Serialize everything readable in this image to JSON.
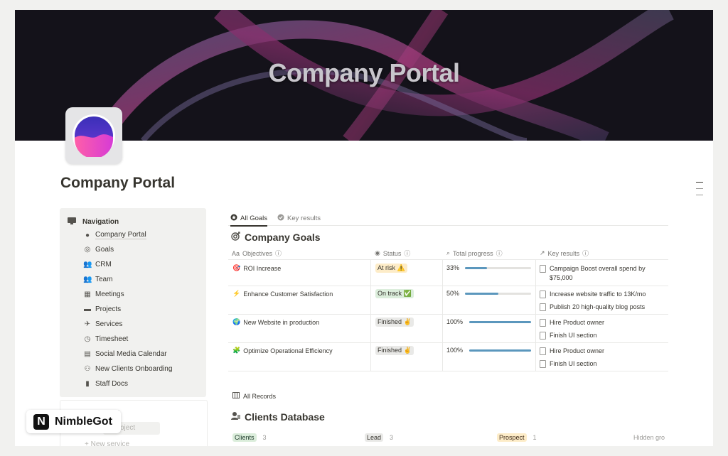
{
  "cover": {
    "title": "Company Portal"
  },
  "page": {
    "title": "Company Portal"
  },
  "navigation": {
    "heading": "Navigation",
    "items": [
      {
        "label": "Company Portal",
        "icon": "portal-icon"
      },
      {
        "label": "Goals",
        "icon": "target-icon"
      },
      {
        "label": "CRM",
        "icon": "people-icon"
      },
      {
        "label": "Team",
        "icon": "team-icon"
      },
      {
        "label": "Meetings",
        "icon": "calendar-icon"
      },
      {
        "label": "Projects",
        "icon": "folder-icon"
      },
      {
        "label": "Services",
        "icon": "airplane-icon"
      },
      {
        "label": "Timesheet",
        "icon": "clock-icon"
      },
      {
        "label": "Social Media Calendar",
        "icon": "calendar-grid-icon"
      },
      {
        "label": "New Clients Onboarding",
        "icon": "group-icon"
      },
      {
        "label": "Staff Docs",
        "icon": "book-icon"
      }
    ],
    "partial": {
      "heading_fragment": "s",
      "project_fragment": "oject",
      "service_fragment": "New service"
    }
  },
  "brand": {
    "logo_letter": "N",
    "name": "NimbleGot"
  },
  "tabs": [
    {
      "label": "All Goals",
      "active": true
    },
    {
      "label": "Key results",
      "active": false
    }
  ],
  "goals": {
    "title": "Company Goals",
    "headers": {
      "objectives": "Objectives",
      "status": "Status",
      "progress": "Total progress",
      "key_results": "Key results"
    },
    "rows": [
      {
        "objective": "ROI Increase",
        "emoji": "🎯",
        "status": "At risk ⚠️",
        "status_color": "#fdecc8",
        "progress_label": "33%",
        "progress": 0.33,
        "key_results": [
          "Campaign Boost overall spend by $75,000"
        ]
      },
      {
        "objective": "Enhance Customer Satisfaction",
        "emoji": "⚡",
        "status": "On track ✅",
        "status_color": "#dbeddb",
        "progress_label": "50%",
        "progress": 0.5,
        "key_results": [
          "Increase website traffic to 13K/mo",
          "Publish 20 high-quality blog posts"
        ]
      },
      {
        "objective": "New Website in production",
        "emoji": "🌍",
        "status": "Finished ✌️",
        "status_color": "#e9e9e7",
        "progress_label": "100%",
        "progress": 1.0,
        "key_results": [
          "Hire Product owner",
          "Finish UI section"
        ]
      },
      {
        "objective": "Optimize Operational Efficiency",
        "emoji": "🧩",
        "status": "Finished ✌️",
        "status_color": "#e9e9e7",
        "progress_label": "100%",
        "progress": 1.0,
        "key_results": [
          "Hire Product owner",
          "Finish UI section"
        ]
      }
    ]
  },
  "records": {
    "tab_label": "All Records",
    "title": "Clients Database",
    "groups": [
      {
        "label": "Clients",
        "count": "3",
        "color": "#dbeddb",
        "text_color": "#1c3829"
      },
      {
        "label": "Lead",
        "count": "3",
        "color": "#e9e9e7",
        "text_color": "#37352f"
      },
      {
        "label": "Prospect",
        "count": "1",
        "color": "#fdecc8",
        "text_color": "#402c1b"
      }
    ],
    "hidden_groups": "Hidden gro"
  }
}
